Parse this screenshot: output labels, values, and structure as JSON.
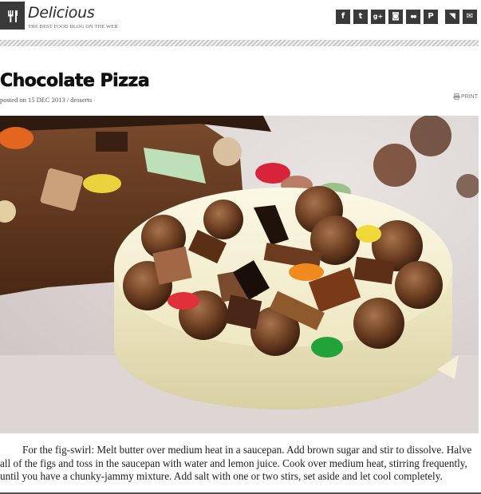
{
  "site": {
    "title": "Delicious",
    "tagline": "THE BEST FOOD BLOG ON THE WEB",
    "logo_icon": "fork-knife-icon"
  },
  "social": [
    {
      "name": "facebook",
      "glyph": "f"
    },
    {
      "name": "twitter",
      "glyph": "t"
    },
    {
      "name": "google-plus",
      "glyph": "g+"
    },
    {
      "name": "instagram",
      "glyph": "◙"
    },
    {
      "name": "flickr",
      "glyph": "●●"
    },
    {
      "name": "pinterest",
      "glyph": "P"
    },
    {
      "name": "rss",
      "glyph": "◥"
    },
    {
      "name": "email",
      "glyph": "✉"
    }
  ],
  "post": {
    "title": "Chocolate Pizza",
    "meta": "posted on 15 DEC 2013 / desserts",
    "print_label": "PRINT",
    "image_alt": "",
    "body": "For the fig-swirl: Melt butter over medium heat in a saucepan. Add brown sugar and stir to dissolve. Halve all of the figs and toss in the saucepan with water and lemon juice. Cook over medium heat, stirring frequently, until you have a chunky-jammy mixture. Add salt with one or two stirs, set aside and let cool completely."
  },
  "colors": {
    "icon_bg": "#3a3a3a",
    "chocolate": "#6b3f24",
    "white_chocolate": "#f4efd6",
    "background": "#ffffff"
  }
}
